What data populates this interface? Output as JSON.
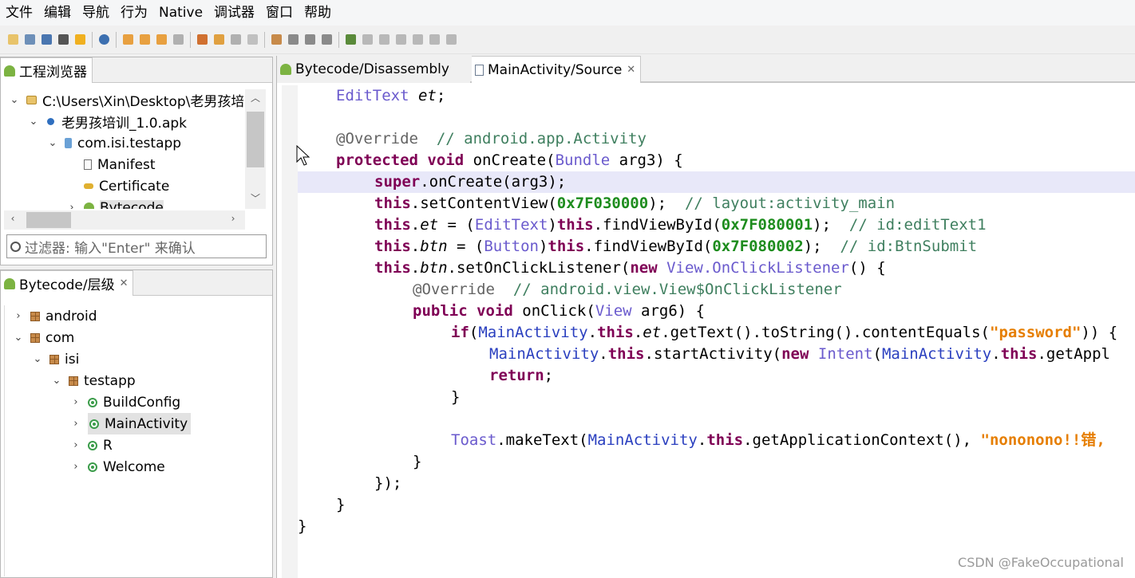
{
  "menubar": [
    "文件",
    "编辑",
    "导航",
    "行为",
    "Native",
    "调试器",
    "窗口",
    "帮助"
  ],
  "project_view": {
    "tab_label": "工程浏览器",
    "tree": [
      {
        "label": "C:\\Users\\Xin\\Desktop\\老男孩培训",
        "indent": 0,
        "twisty": "open",
        "icon": "folder"
      },
      {
        "label": "老男孩培训_1.0.apk",
        "indent": 1,
        "twisty": "open",
        "icon": "apk"
      },
      {
        "label": "com.isi.testapp",
        "indent": 2,
        "twisty": "open",
        "icon": "jar"
      },
      {
        "label": "Manifest",
        "indent": 3,
        "twisty": "none",
        "icon": "file"
      },
      {
        "label": "Certificate",
        "indent": 3,
        "twisty": "none",
        "icon": "key"
      },
      {
        "label": "Bytecode",
        "indent": 3,
        "twisty": "closed",
        "icon": "android"
      }
    ],
    "filter_placeholder": "过滤器: 输入\"Enter\" 来确认"
  },
  "hierarchy_view": {
    "tab_label": "Bytecode/层级",
    "tree": [
      {
        "label": "android",
        "indent": 0,
        "twisty": "closed",
        "icon": "package"
      },
      {
        "label": "com",
        "indent": 0,
        "twisty": "open",
        "icon": "package"
      },
      {
        "label": "isi",
        "indent": 1,
        "twisty": "open",
        "icon": "package"
      },
      {
        "label": "testapp",
        "indent": 2,
        "twisty": "open",
        "icon": "package"
      },
      {
        "label": "BuildConfig",
        "indent": 3,
        "twisty": "closed",
        "icon": "class"
      },
      {
        "label": "MainActivity",
        "indent": 3,
        "twisty": "closed",
        "icon": "class",
        "selected": true
      },
      {
        "label": "R",
        "indent": 3,
        "twisty": "closed",
        "icon": "class"
      },
      {
        "label": "Welcome",
        "indent": 3,
        "twisty": "closed",
        "icon": "class"
      }
    ]
  },
  "editor": {
    "tabs": [
      {
        "label": "Bytecode/Disassembly",
        "active": false
      },
      {
        "label": "MainActivity/Source",
        "active": true
      }
    ],
    "code_lines": [
      "EditText et;",
      "",
      "@Override  // android.app.Activity",
      "protected void onCreate(Bundle arg3) {",
      "super.onCreate(arg3);",
      "this.setContentView(0x7F030000);  // layout:activity_main",
      "this.et = (EditText)this.findViewById(0x7F080001);  // id:editText1",
      "this.btn = (Button)this.findViewById(0x7F080002);  // id:BtnSubmit",
      "this.btn.setOnClickListener(new View.OnClickListener() {",
      "@Override  // android.view.View$OnClickListener",
      "public void onClick(View arg6) {",
      "if(MainActivity.this.et.getText().toString().contentEquals(\"password\")) {",
      "MainActivity.this.startActivity(new Intent(MainActivity.this.getAppl",
      "return;",
      "}",
      "",
      "Toast.makeText(MainActivity.this.getApplicationContext(), \"nononono!!错,",
      "}",
      "});",
      "}",
      "}"
    ]
  },
  "watermark": "CSDN @FakeOccupational",
  "colors": {
    "keyword": "#7f0055",
    "type": "#6a5acd",
    "comment": "#3f7f5f",
    "number": "#1d8c1d",
    "string": "#e67e00",
    "highlight_line": "#e8e8f9"
  }
}
